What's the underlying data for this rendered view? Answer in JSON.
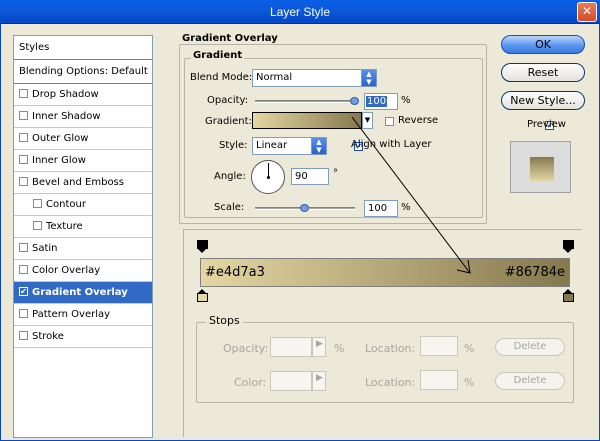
{
  "window": {
    "title": "Layer Style",
    "close_glyph": "✕"
  },
  "styles_panel": {
    "header": "Styles",
    "blending": "Blending Options: Default",
    "items": [
      {
        "label": "Drop Shadow",
        "checked": false,
        "indent": false
      },
      {
        "label": "Inner Shadow",
        "checked": false,
        "indent": false
      },
      {
        "label": "Outer Glow",
        "checked": false,
        "indent": false
      },
      {
        "label": "Inner Glow",
        "checked": false,
        "indent": false
      },
      {
        "label": "Bevel and Emboss",
        "checked": false,
        "indent": false
      },
      {
        "label": "Contour",
        "checked": false,
        "indent": true
      },
      {
        "label": "Texture",
        "checked": false,
        "indent": true
      },
      {
        "label": "Satin",
        "checked": false,
        "indent": false
      },
      {
        "label": "Color Overlay",
        "checked": false,
        "indent": false
      },
      {
        "label": "Gradient Overlay",
        "checked": true,
        "indent": false,
        "selected": true
      },
      {
        "label": "Pattern Overlay",
        "checked": false,
        "indent": false
      },
      {
        "label": "Stroke",
        "checked": false,
        "indent": false
      }
    ]
  },
  "gradient_overlay": {
    "section_title": "Gradient Overlay",
    "group_title": "Gradient",
    "blend_mode_label": "Blend Mode:",
    "blend_mode_value": "Normal",
    "opacity_label": "Opacity:",
    "opacity_value": "100",
    "opacity_unit": "%",
    "opacity_level": 1.0,
    "gradient_label": "Gradient:",
    "reverse_label": "Reverse",
    "style_label": "Style:",
    "style_value": "Linear",
    "align_label": "Align with Layer",
    "align_checked": true,
    "angle_label": "Angle:",
    "angle_value": "90",
    "angle_unit": "°",
    "scale_label": "Scale:",
    "scale_value": "100",
    "scale_unit": "%",
    "scale_level": 0.5,
    "gradient_start": "#e4d7a3",
    "gradient_end": "#86784e"
  },
  "buttons": {
    "ok": "OK",
    "reset": "Reset",
    "new_style": "New Style...",
    "preview_label": "Preview",
    "preview_checked": true
  },
  "gradient_editor": {
    "start_color_text": "#e4d7a3",
    "end_color_text": "#86784e",
    "stops_title": "Stops",
    "opacity_label": "Opacity:",
    "opacity_unit": "%",
    "location_label": "Location:",
    "location_unit": "%",
    "color_label": "Color:",
    "delete_label": "Delete"
  }
}
